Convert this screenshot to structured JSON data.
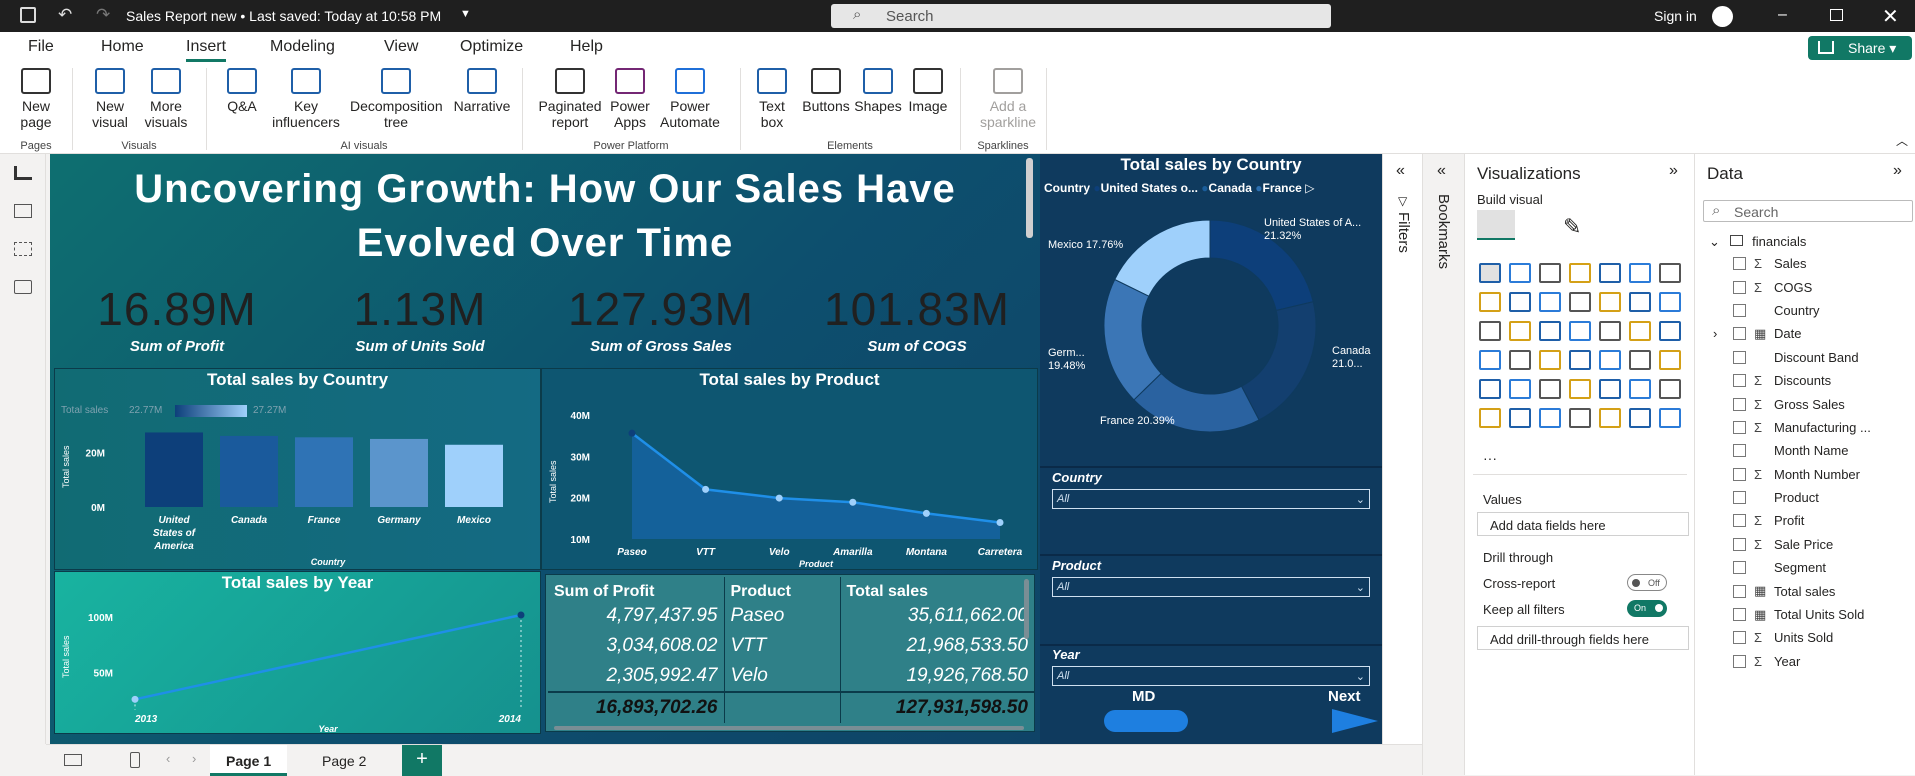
{
  "window": {
    "title": "Sales Report new • Last saved: Today at 10:58 PM",
    "search_placeholder": "Search",
    "sign_in": "Sign in"
  },
  "menu": [
    "File",
    "Home",
    "Insert",
    "Modeling",
    "View",
    "Optimize",
    "Help"
  ],
  "share_label": "Share",
  "ribbon": {
    "buttons": [
      {
        "label": "New\npage",
        "icon": "new-page-icon"
      },
      {
        "label": "New\nvisual",
        "icon": "new-visual-icon"
      },
      {
        "label": "More\nvisuals",
        "icon": "more-visuals-icon"
      },
      {
        "label": "Q&A",
        "icon": "qa-icon"
      },
      {
        "label": "Key\ninfluencers",
        "icon": "key-influencers-icon"
      },
      {
        "label": "Decomposition\ntree",
        "icon": "decomposition-tree-icon"
      },
      {
        "label": "Narrative",
        "icon": "narrative-icon"
      },
      {
        "label": "Paginated\nreport",
        "icon": "paginated-report-icon"
      },
      {
        "label": "Power\nApps",
        "icon": "power-apps-icon"
      },
      {
        "label": "Power\nAutomate",
        "icon": "power-automate-icon"
      },
      {
        "label": "Text\nbox",
        "icon": "text-box-icon"
      },
      {
        "label": "Buttons",
        "icon": "buttons-icon"
      },
      {
        "label": "Shapes",
        "icon": "shapes-icon"
      },
      {
        "label": "Image",
        "icon": "image-icon"
      },
      {
        "label": "Add a\nsparkline",
        "icon": "sparkline-icon"
      }
    ],
    "groups": [
      "Pages",
      "Visuals",
      "AI visuals",
      "Power Platform",
      "Elements",
      "Sparklines"
    ]
  },
  "report": {
    "title": "Uncovering Growth: How Our Sales Have Evolved Over Time",
    "kpis": [
      {
        "value": "16.89M",
        "label": "Sum of Profit"
      },
      {
        "value": "1.13M",
        "label": "Sum of Units Sold"
      },
      {
        "value": "127.93M",
        "label": "Sum of Gross Sales"
      },
      {
        "value": "101.83M",
        "label": "Sum of COGS"
      }
    ],
    "country_bar": {
      "title": "Total sales by Country",
      "legend_label": "Total sales",
      "legend_min": "22.77M",
      "legend_max": "27.27M",
      "yticks": [
        "20M",
        "0M"
      ],
      "ylabel": "Total sales",
      "xlabel": "Country",
      "categories": [
        "United States of America",
        "Canada",
        "France",
        "Germany",
        "Mexico"
      ]
    },
    "product_line": {
      "title": "Total sales by Product",
      "yticks": [
        "40M",
        "30M",
        "20M",
        "10M"
      ],
      "ylabel": "Total sales",
      "xlabel": "Product",
      "categories": [
        "Paseo",
        "VTT",
        "Velo",
        "Amarilla",
        "Montana",
        "Carretera"
      ]
    },
    "year_line": {
      "title": "Total sales by Year",
      "yticks": [
        "100M",
        "50M"
      ],
      "ylabel": "Total sales",
      "xlabel": "Year",
      "categories": [
        "2013",
        "2014"
      ]
    },
    "table": {
      "headers": [
        "Sum of Profit",
        "Product",
        "Total sales"
      ],
      "rows": [
        [
          "4,797,437.95",
          "Paseo",
          "35,611,662.00"
        ],
        [
          "3,034,608.02",
          "VTT",
          "21,968,533.50"
        ],
        [
          "2,305,992.47",
          "Velo",
          "19,926,768.50"
        ]
      ],
      "total": [
        "16,893,702.26",
        "",
        "127,931,598.50"
      ]
    },
    "donut": {
      "title": "Total sales by Country",
      "legend_title": "Country",
      "legend": [
        "United States o...",
        "Canada",
        "France"
      ],
      "labels": [
        "United States of A... 21.32%",
        "Canada 21.0...",
        "France 20.39%",
        "Germ... 19.48%",
        "Mexico 17.76%"
      ]
    },
    "slicers": [
      {
        "title": "Country",
        "value": "All"
      },
      {
        "title": "Product",
        "value": "All"
      },
      {
        "title": "Year",
        "value": "All"
      }
    ],
    "nav": {
      "md": "MD",
      "next": "Next"
    }
  },
  "chart_data": [
    {
      "type": "bar",
      "title": "Total sales by Country",
      "xlabel": "Country",
      "ylabel": "Total sales",
      "categories": [
        "United States of America",
        "Canada",
        "France",
        "Germany",
        "Mexico"
      ],
      "values": [
        27.27,
        26.0,
        25.5,
        24.9,
        22.77
      ],
      "ylim": [
        0,
        30
      ]
    },
    {
      "type": "area",
      "title": "Total sales by Product",
      "xlabel": "Product",
      "ylabel": "Total sales",
      "categories": [
        "Paseo",
        "VTT",
        "Velo",
        "Amarilla",
        "Montana",
        "Carretera"
      ],
      "values": [
        35.6,
        22.0,
        19.9,
        18.9,
        16.2,
        14.0
      ],
      "ylim": [
        10,
        40
      ]
    },
    {
      "type": "line",
      "title": "Total sales by Year",
      "xlabel": "Year",
      "ylabel": "Total sales",
      "categories": [
        "2013",
        "2014"
      ],
      "values": [
        26.0,
        101.9
      ],
      "ylim": [
        20,
        110
      ]
    },
    {
      "type": "pie",
      "title": "Total sales by Country",
      "categories": [
        "United States of America",
        "Canada",
        "France",
        "Germany",
        "Mexico"
      ],
      "values": [
        21.32,
        21.0,
        20.39,
        19.48,
        17.76
      ]
    }
  ],
  "panes": {
    "filters": "Filters",
    "bookmarks": "Bookmarks",
    "viz_title": "Visualizations",
    "build_visual": "Build visual",
    "values": "Values",
    "add_data": "Add data fields here",
    "drill": "Drill through",
    "cross_report": "Cross-report",
    "cross_state": "Off",
    "keep_filters": "Keep all filters",
    "keep_state": "On",
    "add_drill": "Add drill-through fields here",
    "data_title": "Data",
    "data_search": "Search",
    "table_name": "financials",
    "fields": [
      {
        "name": "Sales",
        "sigma": true
      },
      {
        "name": "COGS",
        "sigma": true
      },
      {
        "name": "Country",
        "sigma": false
      },
      {
        "name": "Date",
        "sigma": false,
        "expand": true
      },
      {
        "name": "Discount Band",
        "sigma": false
      },
      {
        "name": "Discounts",
        "sigma": true
      },
      {
        "name": "Gross Sales",
        "sigma": true
      },
      {
        "name": "Manufacturing ...",
        "sigma": true
      },
      {
        "name": "Month Name",
        "sigma": false
      },
      {
        "name": "Month Number",
        "sigma": true
      },
      {
        "name": "Product",
        "sigma": false
      },
      {
        "name": "Profit",
        "sigma": true
      },
      {
        "name": "Sale Price",
        "sigma": true
      },
      {
        "name": "Segment",
        "sigma": false
      },
      {
        "name": "Total sales",
        "sigma": false,
        "calc": true
      },
      {
        "name": "Total Units Sold",
        "sigma": false,
        "calc": true
      },
      {
        "name": "Units Sold",
        "sigma": true
      },
      {
        "name": "Year",
        "sigma": true
      }
    ]
  },
  "pages": [
    "Page 1",
    "Page 2"
  ],
  "colors": {
    "accent": "#117865",
    "bar_dark": "#0d3f7a",
    "bar_light": "#9fd0fb",
    "line": "#1f8fe8"
  }
}
